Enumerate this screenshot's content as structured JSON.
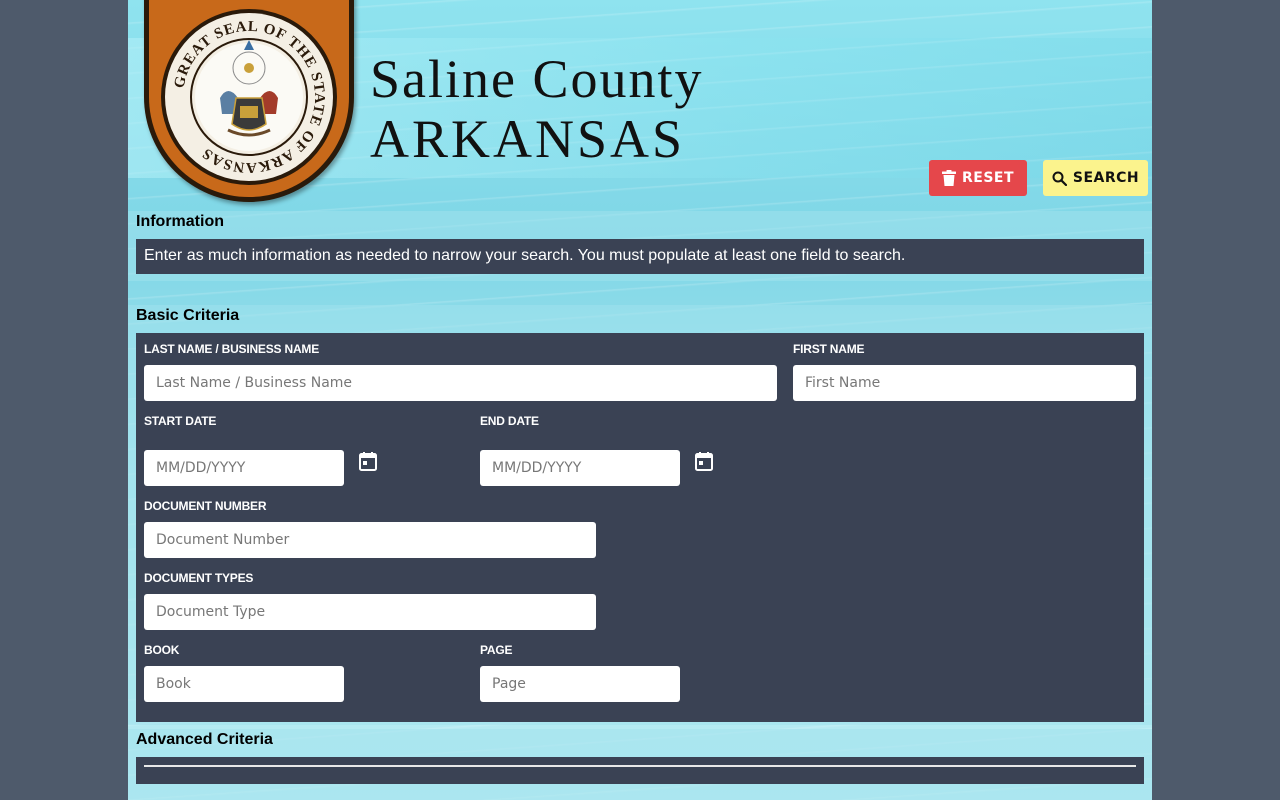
{
  "header": {
    "seal_text": "GREAT SEAL OF THE STATE OF ARKANSAS",
    "brand_line1": "Saline County",
    "brand_line2": "ARKANSAS"
  },
  "toolbar": {
    "reset_label": "RESET",
    "search_label": "SEARCH"
  },
  "information": {
    "title": "Information",
    "text": "Enter as much information as needed to narrow your search. You must populate at least one field to search."
  },
  "basic": {
    "title": "Basic Criteria",
    "last_name": {
      "label": "LAST NAME / BUSINESS NAME",
      "placeholder": "Last Name / Business Name",
      "value": ""
    },
    "first_name": {
      "label": "FIRST NAME",
      "placeholder": "First Name",
      "value": ""
    },
    "start_date": {
      "label": "START DATE",
      "placeholder": "MM/DD/YYYY",
      "value": ""
    },
    "end_date": {
      "label": "END DATE",
      "placeholder": "MM/DD/YYYY",
      "value": ""
    },
    "document_number": {
      "label": "DOCUMENT NUMBER",
      "placeholder": "Document Number",
      "value": ""
    },
    "document_types": {
      "label": "DOCUMENT TYPES",
      "placeholder": "Document Type",
      "value": ""
    },
    "book": {
      "label": "BOOK",
      "placeholder": "Book",
      "value": ""
    },
    "page": {
      "label": "PAGE",
      "placeholder": "Page",
      "value": ""
    }
  },
  "advanced": {
    "title": "Advanced Criteria"
  },
  "icons": {
    "reset": "trash-icon",
    "search": "search-icon",
    "start_date": "calendar-icon",
    "end_date": "calendar-icon"
  },
  "colors": {
    "page_background": "#4e5a6b",
    "panel": "#3a4254",
    "reset_button": "#e5474b",
    "search_button": "#fbf38d",
    "seal_shield": "#c8691a"
  }
}
